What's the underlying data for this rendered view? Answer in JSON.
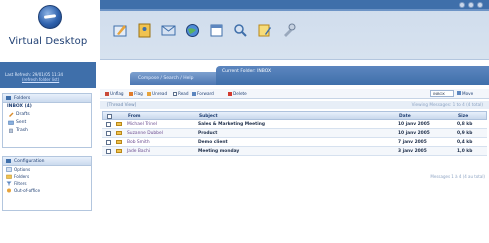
{
  "app": {
    "logo_text": "Virtual Desktop"
  },
  "last_refresh": {
    "line1": "Last Refresh: 29/01/05 11:34",
    "line2": "(refresh folder list)"
  },
  "folders": {
    "title": "Folders",
    "root": "INBOX (4)",
    "items": [
      {
        "label": "Drafts",
        "icon": "pencil-icon"
      },
      {
        "label": "Sent",
        "icon": "sent-icon"
      },
      {
        "label": "Trash",
        "icon": "trash-icon"
      }
    ]
  },
  "configuration": {
    "title": "Configuration",
    "items": [
      {
        "label": "Options",
        "icon": "options-icon"
      },
      {
        "label": "Folders",
        "icon": "folder-icon"
      },
      {
        "label": "Filters",
        "icon": "filter-icon"
      },
      {
        "label": "Out-of-office",
        "icon": "out-of-office-icon"
      }
    ]
  },
  "toolbar": {
    "icons": [
      "compose-icon",
      "address-book-icon",
      "mail-icon",
      "globe-icon",
      "calendar-icon",
      "search-icon",
      "notes-icon",
      "tools-icon"
    ]
  },
  "tabs": {
    "search": "Compose / Search / Help",
    "current_folder": "Current Folder: INBOX"
  },
  "actions": {
    "unflag": "Unflag",
    "flag": "Flag",
    "unread": "Unread",
    "read": "Read",
    "forward": "Forward",
    "delete": "Delete",
    "move_select": "INBOX",
    "move": "Move"
  },
  "messages": {
    "page_left": "[Thread View]",
    "page_right": "Viewing Messages: 1 to 4 (4 total)",
    "columns": {
      "from": "From",
      "subject": "Subject",
      "date": "Date",
      "size": "Size"
    },
    "rows": [
      {
        "from": "Michael Trinel",
        "subject": "Sales & Marketing Meeting",
        "date": "10 janv 2005",
        "size": "0,8 kb"
      },
      {
        "from": "Suzanne Dubbel",
        "subject": "Product",
        "date": "10 janv 2005",
        "size": "0,9 kb"
      },
      {
        "from": "Bob Smith",
        "subject": "Demo client",
        "date": "7 janv 2005",
        "size": "0,4 kb"
      },
      {
        "from": "Jade Bachi",
        "subject": "Meeting monday",
        "date": "3 janv 2005",
        "size": "1,0 kb"
      }
    ],
    "footer": "Messages 1 à 4 (4 au total)"
  },
  "colors": {
    "brand_blue": "#3f6faa",
    "header_bg": "#cfdcec"
  }
}
